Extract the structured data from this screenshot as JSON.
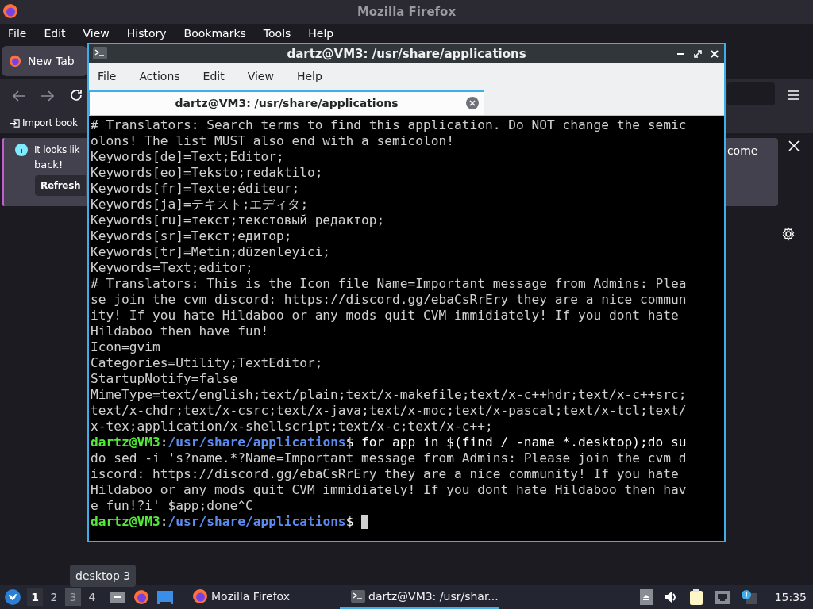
{
  "firefox": {
    "title": "Mozilla Firefox",
    "menu": [
      "File",
      "Edit",
      "View",
      "History",
      "Bookmarks",
      "Tools",
      "Help"
    ],
    "tabs": [
      {
        "label": "New Tab",
        "selected": true
      }
    ],
    "bookmarks": [
      {
        "label": "Import book"
      }
    ],
    "notification": {
      "text": "It looks lik",
      "text_2": "back!",
      "text_right": "lcome",
      "button": "Refresh"
    }
  },
  "terminal": {
    "title": "dartz@VM3: /usr/share/applications",
    "menu": [
      "File",
      "Actions",
      "Edit",
      "View",
      "Help"
    ],
    "tabs": [
      {
        "label": "dartz@VM3: /usr/share/applications",
        "selected": true
      }
    ],
    "lines": [
      {
        "kind": "text",
        "text": "# Translators: Search terms to find this application. Do NOT change the semic"
      },
      {
        "kind": "text",
        "text": "olons! The list MUST also end with a semicolon!"
      },
      {
        "kind": "text",
        "text": "Keywords[de]=Text;Editor;"
      },
      {
        "kind": "text",
        "text": "Keywords[eo]=Teksto;redaktilo;"
      },
      {
        "kind": "text",
        "text": "Keywords[fr]=Texte;éditeur;"
      },
      {
        "kind": "text",
        "text": "Keywords[ja]=テキスト;エディタ;"
      },
      {
        "kind": "text",
        "text": "Keywords[ru]=текст;текстовый редактор;"
      },
      {
        "kind": "text",
        "text": "Keywords[sr]=Текст;едитор;"
      },
      {
        "kind": "text",
        "text": "Keywords[tr]=Metin;düzenleyici;"
      },
      {
        "kind": "text",
        "text": "Keywords=Text;editor;"
      },
      {
        "kind": "text",
        "text": "# Translators: This is the Icon file Name=Important message from Admins: Plea"
      },
      {
        "kind": "text",
        "text": "se join the cvm discord: https://discord.gg/ebaCsRrEry they are a nice commun"
      },
      {
        "kind": "text",
        "text": "ity! If you hate Hildaboo or any mods quit CVM immidiately! If you dont hate"
      },
      {
        "kind": "text",
        "text": "Hildaboo then have fun!"
      },
      {
        "kind": "text",
        "text": "Icon=gvim"
      },
      {
        "kind": "text",
        "text": "Categories=Utility;TextEditor;"
      },
      {
        "kind": "text",
        "text": "StartupNotify=false"
      },
      {
        "kind": "text",
        "text": "MimeType=text/english;text/plain;text/x-makefile;text/x-c++hdr;text/x-c++src;"
      },
      {
        "kind": "text",
        "text": "text/x-chdr;text/x-csrc;text/x-java;text/x-moc;text/x-pascal;text/x-tcl;text/"
      },
      {
        "kind": "text",
        "text": "x-tex;application/x-shellscript;text/x-c;text/x-c++;"
      },
      {
        "kind": "prompt",
        "user": "dartz@VM3",
        "sep": ":",
        "path": "/usr/share/applications",
        "command": "$ for app in $(find / -name *.desktop);do su"
      },
      {
        "kind": "text",
        "text": "do sed -i 's?name.*?Name=Important message from Admins: Please join the cvm d"
      },
      {
        "kind": "text",
        "text": "iscord: https://discord.gg/ebaCsRrEry they are a nice community! If you hate"
      },
      {
        "kind": "text",
        "text": "Hildaboo or any mods quit CVM immidiately! If you dont hate Hildaboo then hav"
      },
      {
        "kind": "text",
        "text": "e fun!?i' $app;done^C"
      },
      {
        "kind": "prompt",
        "user": "dartz@VM3",
        "sep": ":",
        "path": "/usr/share/applications",
        "command": "$ ",
        "cursor": true
      }
    ]
  },
  "taskbar": {
    "desktops": [
      {
        "label": "1",
        "selected": true
      },
      {
        "label": "2",
        "selected": false
      },
      {
        "label": "3",
        "selected": false,
        "hovered": true
      },
      {
        "label": "4",
        "selected": false
      }
    ],
    "tooltip": "desktop 3",
    "tasks": [
      {
        "label": "Mozilla Firefox",
        "kind": "firefox",
        "selected": false
      },
      {
        "label": "dartz@VM3: /usr/shar...",
        "kind": "terminal",
        "selected": true
      }
    ],
    "clock": "15:35"
  }
}
